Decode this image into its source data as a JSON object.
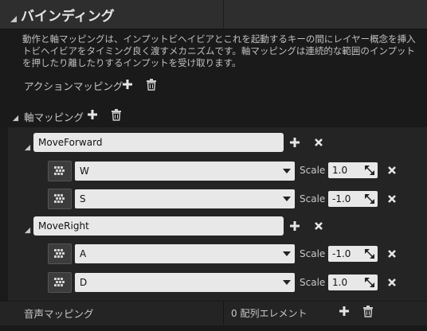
{
  "section": {
    "title": "バインディング"
  },
  "description": {
    "line1": "動作と軸マッピングは、インプットビヘイビアとこれを起動するキーの間にレイヤー概念を挿入",
    "line2": "トビヘイビアをタイミング良く渡すメカニズムです。軸マッピングは連続的な範囲のインプット",
    "line3": "を押したり離したりするインプットを受け取ります。"
  },
  "action_mappings": {
    "label": "アクションマッピング"
  },
  "axis_mappings": {
    "label": "軸マッピング",
    "groups": [
      {
        "name": "MoveForward",
        "entries": [
          {
            "key": "W",
            "scale_label": "Scale",
            "scale": "1.0"
          },
          {
            "key": "S",
            "scale_label": "Scale",
            "scale": "-1.0"
          }
        ]
      },
      {
        "name": "MoveRight",
        "entries": [
          {
            "key": "A",
            "scale_label": "Scale",
            "scale": "-1.0"
          },
          {
            "key": "D",
            "scale_label": "Scale",
            "scale": "1.0"
          }
        ]
      }
    ]
  },
  "speech_mappings": {
    "label": "音声マッピング",
    "count_text": "0 配列エレメント"
  },
  "colors": {
    "add": "#e6e6e6",
    "remove": "#e6e6e6",
    "field_bg": "#e8e8e8",
    "bg": "#1a1a1a"
  },
  "icons": [
    "expand-arrow-icon",
    "plus-icon",
    "trash-icon",
    "close-icon",
    "keyboard-icon",
    "dropdown-arrow-icon"
  ]
}
